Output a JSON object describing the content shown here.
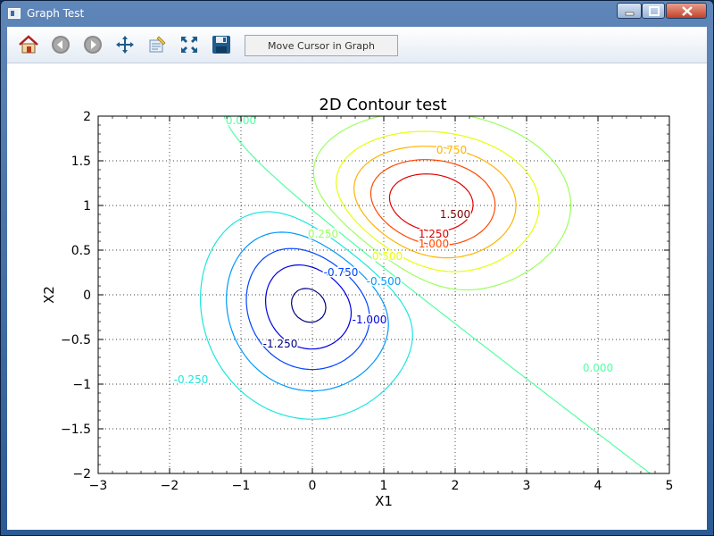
{
  "window": {
    "title": "Graph Test"
  },
  "toolbar": {
    "buttons": [
      {
        "name": "home-icon",
        "label": "Home"
      },
      {
        "name": "back-icon",
        "label": "Back"
      },
      {
        "name": "forward-icon",
        "label": "Forward"
      },
      {
        "name": "pan-icon",
        "label": "Pan"
      },
      {
        "name": "edit-axes-icon",
        "label": "Edit"
      },
      {
        "name": "zoom-fit-icon",
        "label": "Fit"
      },
      {
        "name": "save-icon",
        "label": "Save"
      }
    ],
    "status_text": "Move Cursor in Graph"
  },
  "chart_data": {
    "type": "contour",
    "title": "2D Contour test",
    "xlabel": "X1",
    "ylabel": "X2",
    "xlim": [
      -3,
      5
    ],
    "ylim": [
      -2,
      2
    ],
    "xticks": [
      -3,
      -2,
      -1,
      0,
      1,
      2,
      3,
      4,
      5
    ],
    "yticks": [
      -2,
      -1.5,
      -1,
      -0.5,
      0,
      0.5,
      1,
      1.5,
      2
    ],
    "xtick_labels": [
      "−3",
      "−2",
      "−1",
      "0",
      "1",
      "2",
      "3",
      "4",
      "5"
    ],
    "ytick_labels": [
      "−2",
      "−1.5",
      "−1",
      "−0.5",
      "0",
      "0.5",
      "1",
      "1.5",
      "2"
    ],
    "grid": true,
    "grid_style": "dotted",
    "levels": [
      -1.25,
      -1.0,
      -0.75,
      -0.5,
      -0.25,
      0.0,
      0.25,
      0.5,
      0.75,
      1.0,
      1.25,
      1.5
    ],
    "level_colors": [
      "#00007f",
      "#0000e0",
      "#0044ff",
      "#0098ff",
      "#1ee6dc",
      "#54ffa3",
      "#9aff5d",
      "#e6ff0a",
      "#ffb200",
      "#ff4800",
      "#e10000",
      "#7f0000"
    ],
    "peaks": [
      {
        "kind": "maximum",
        "x": 1.5,
        "y": 1.0,
        "value": 1.6
      },
      {
        "kind": "minimum",
        "x": 0.0,
        "y": 0.0,
        "value": -1.4
      }
    ],
    "contour_labels": [
      {
        "text": "0.000",
        "x": -1.0,
        "y": 1.95
      },
      {
        "text": "0.750",
        "x": 1.95,
        "y": 1.62
      },
      {
        "text": "1.500",
        "x": 2.0,
        "y": 0.9
      },
      {
        "text": "1.250",
        "x": 1.7,
        "y": 0.68
      },
      {
        "text": "1.000",
        "x": 1.7,
        "y": 0.57
      },
      {
        "text": "0.500",
        "x": 1.05,
        "y": 0.43
      },
      {
        "text": "0.250",
        "x": 0.15,
        "y": 0.68
      },
      {
        "text": "-0.750",
        "x": 0.4,
        "y": 0.25
      },
      {
        "text": "-0.500",
        "x": 1.0,
        "y": 0.15
      },
      {
        "text": "-1.000",
        "x": 0.8,
        "y": -0.28
      },
      {
        "text": "-1.250",
        "x": -0.45,
        "y": -0.55
      },
      {
        "text": "-0.250",
        "x": -1.7,
        "y": -0.95
      },
      {
        "text": "0.000",
        "x": 4.0,
        "y": -0.82
      }
    ]
  }
}
